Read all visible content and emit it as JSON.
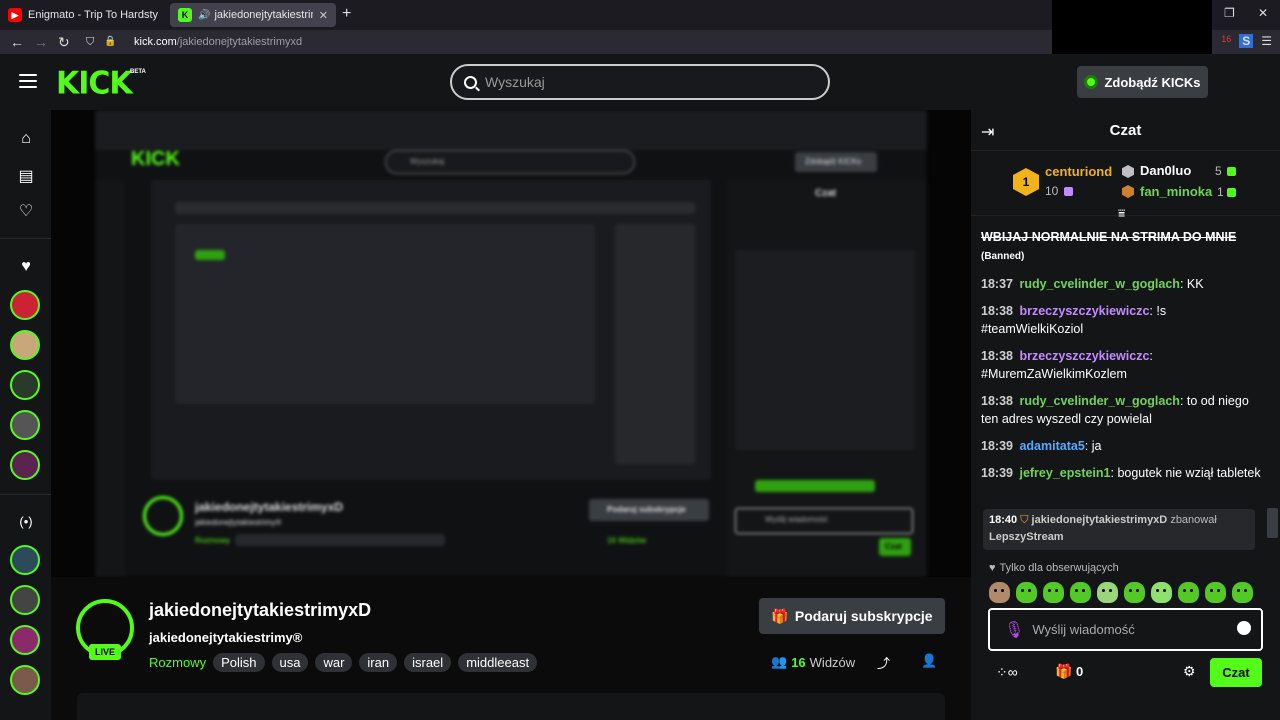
{
  "browser": {
    "tabs": [
      {
        "title": "Enigmato - Trip To Hardstyl"
      },
      {
        "title": "jakiedonejtytakiestrimyxD"
      }
    ],
    "url_domain": "kick.com",
    "url_path": "/jakiedonejtytakiestrimyxd",
    "notif_count": "16"
  },
  "header": {
    "logo": "KICK",
    "beta": "BETA",
    "search_placeholder": "Wyszukaj",
    "get_kicks": "Zdobądź KICKs"
  },
  "stream": {
    "channel_name": "jakiedonejtytakiestrimyxD",
    "subtitle": "jakiedonejtytakiestrimy®",
    "live_label": "LIVE",
    "category": "Rozmowy",
    "tags": [
      "Polish",
      "usa",
      "war",
      "iran",
      "israel",
      "middleeast"
    ],
    "gift_button": "Podaruj subskrypcje",
    "viewers_count": "16",
    "viewers_label": "Widzów"
  },
  "video_preview": {
    "logo": "KICK",
    "search": "Wyszukaj",
    "get_kicks": "Zdobądź KICKs",
    "chat_title": "Czat",
    "channel_name": "jakiedonejtytakiestrimyxD",
    "subtitle": "jakiedonejtytakiestrimy®",
    "category": "Rozmowy",
    "tags": [
      "Polish",
      "usa",
      "war",
      "iran",
      "israel",
      "middleeast"
    ],
    "gift": "Podaruj subskrypcje",
    "viewers": "16 Widzów",
    "input": "Wyślij wiadomość",
    "send": "Czat"
  },
  "chat": {
    "title": "Czat",
    "leaderboard": [
      {
        "rank": "1",
        "name": "centuriond",
        "count": "10",
        "color": "#f2b21a"
      },
      {
        "rank": "2",
        "name": "Dan0luo",
        "count": "5",
        "color": "#c0c0c0"
      },
      {
        "rank": "3",
        "name": "fan_minoka",
        "count": "1",
        "color": "#cd7f32"
      }
    ],
    "messages": [
      {
        "time": "",
        "user": "",
        "color": "#ffffff",
        "text": "WBIJAJ NORMALNIE NA STRIMA DO MNIE",
        "tag": "(Banned)"
      },
      {
        "time": "18:37",
        "user": "rudy_cvelinder_w_goglach",
        "color": "#72d35a",
        "text": "KK"
      },
      {
        "time": "18:38",
        "user": "brzeczyszczykiewiczc",
        "color": "#c48aff",
        "text": "!s #teamWielkiKoziol"
      },
      {
        "time": "18:38",
        "user": "brzeczyszczykiewiczc",
        "color": "#c48aff",
        "text": "#MuremZaWielkimKozlem"
      },
      {
        "time": "18:38",
        "user": "rudy_cvelinder_w_goglach",
        "color": "#72d35a",
        "text": "to od niego ten adres wyszedl czy powielal"
      },
      {
        "time": "18:39",
        "user": "adamitata5",
        "color": "#5aa8ff",
        "text": "ja"
      },
      {
        "time": "18:39",
        "user": "jefrey_epstein1",
        "color": "#72d35a",
        "text": "bogutek nie wziął tabletek"
      }
    ],
    "system_message": {
      "time": "18:40",
      "moderator": "jakiedonejtytakiestrimyxD",
      "action": "zbanował",
      "target": "LepszyStream"
    },
    "followers_only": "Tylko dla obserwujących",
    "input_placeholder": "Wyślij wiadomość",
    "kicks_count": "0",
    "send_button": "Czat"
  },
  "colors": {
    "accent": "#53fc18",
    "background": "#0b0b0c",
    "panel": "#141517"
  }
}
